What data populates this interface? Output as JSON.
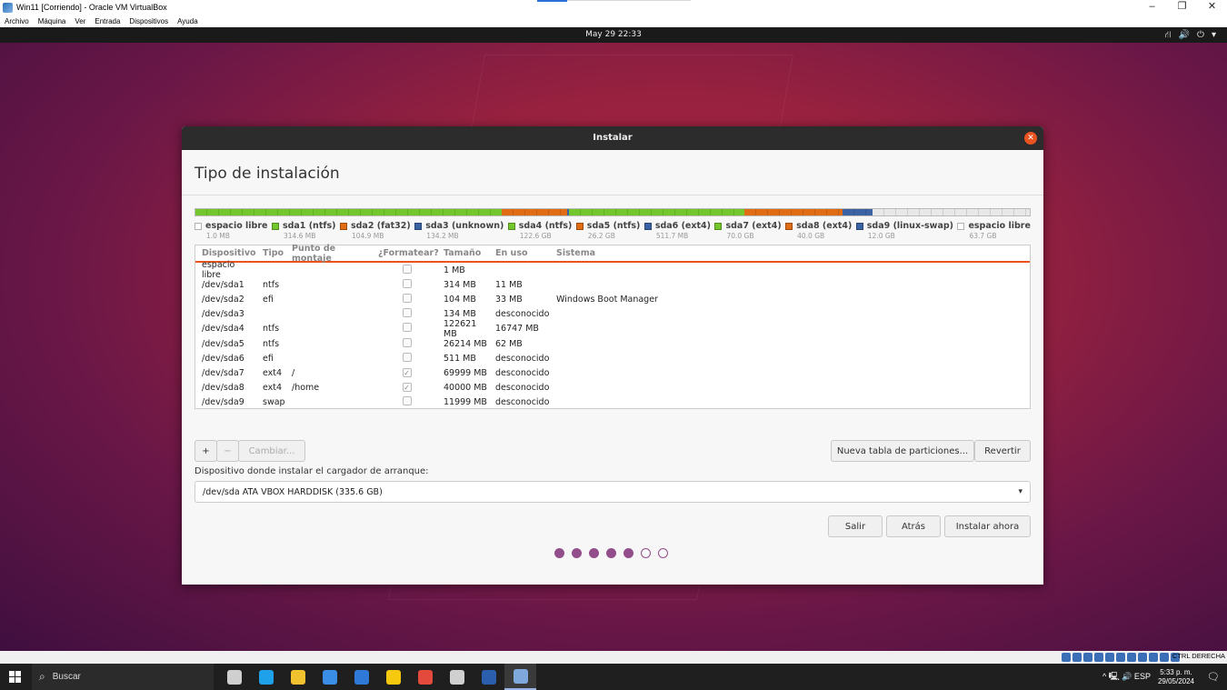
{
  "host_window": {
    "title": "Win11 [Corriendo] - Oracle VM VirtualBox",
    "menu": [
      "Archivo",
      "Máquina",
      "Ver",
      "Entrada",
      "Dispositivos",
      "Ayuda"
    ],
    "controls": {
      "minimize": "–",
      "restore": "❐",
      "close": "✕"
    }
  },
  "ubuntu_topbar": {
    "clock": "May 29  22:33",
    "tray_icons": [
      "network-icon",
      "volume-icon",
      "power-icon",
      "menu-arrow-icon"
    ],
    "tray_glyphs": [
      "⛙",
      "🔊",
      "⏻",
      "▾"
    ]
  },
  "dialog": {
    "header": "Instalar",
    "close_glyph": "✕",
    "title": "Tipo de instalación",
    "partitions_bar": [
      {
        "color": "#f0f0f0",
        "weight": 0.4
      },
      {
        "color": "#73c72c",
        "weight": 337.6
      },
      {
        "color": "#e06d14",
        "weight": 72.4
      },
      {
        "color": "#3b63a3",
        "weight": 1.2
      },
      {
        "color": "#73c72c",
        "weight": 193.8
      },
      {
        "color": "#e06d14",
        "weight": 108.6
      },
      {
        "color": "#3b63a3",
        "weight": 32.8
      },
      {
        "color": "#e8e8e8",
        "weight": 173.2
      }
    ],
    "legend": [
      {
        "name": "espacio libre",
        "size": "1.0 MB",
        "color": "#ffffff"
      },
      {
        "name": "sda1 (ntfs)",
        "size": "314.6 MB",
        "color": "#73c72c"
      },
      {
        "name": "sda2 (fat32)",
        "size": "104.9 MB",
        "color": "#e06d14"
      },
      {
        "name": "sda3 (unknown)",
        "size": "134.2 MB",
        "color": "#3b63a3"
      },
      {
        "name": "sda4 (ntfs)",
        "size": "122.6 GB",
        "color": "#73c72c"
      },
      {
        "name": "sda5 (ntfs)",
        "size": "26.2 GB",
        "color": "#e06d14"
      },
      {
        "name": "sda6 (ext4)",
        "size": "511.7 MB",
        "color": "#3b63a3"
      },
      {
        "name": "sda7 (ext4)",
        "size": "70.0 GB",
        "color": "#73c72c"
      },
      {
        "name": "sda8 (ext4)",
        "size": "40.0 GB",
        "color": "#e06d14"
      },
      {
        "name": "sda9 (linux-swap)",
        "size": "12.0 GB",
        "color": "#3b63a3"
      },
      {
        "name": "espacio libre",
        "size": "63.7 GB",
        "color": "#ffffff"
      }
    ],
    "table": {
      "headers": [
        "Dispositivo",
        "Tipo",
        "Punto de montaje",
        "¿Formatear?",
        "Tamaño",
        "En uso",
        "Sistema"
      ],
      "rows": [
        {
          "dev": "espacio libre",
          "type": "",
          "mount": "",
          "fmt": "",
          "size": "1 MB",
          "use": "",
          "sys": ""
        },
        {
          "dev": "/dev/sda1",
          "type": "ntfs",
          "mount": "",
          "fmt": "",
          "size": "314 MB",
          "use": "11 MB",
          "sys": ""
        },
        {
          "dev": "/dev/sda2",
          "type": "efi",
          "mount": "",
          "fmt": "",
          "size": "104 MB",
          "use": "33 MB",
          "sys": "Windows Boot Manager"
        },
        {
          "dev": "/dev/sda3",
          "type": "",
          "mount": "",
          "fmt": "",
          "size": "134 MB",
          "use": "desconocido",
          "sys": ""
        },
        {
          "dev": "/dev/sda4",
          "type": "ntfs",
          "mount": "",
          "fmt": "",
          "size": "122621 MB",
          "use": "16747 MB",
          "sys": ""
        },
        {
          "dev": "/dev/sda5",
          "type": "ntfs",
          "mount": "",
          "fmt": "",
          "size": "26214 MB",
          "use": "62 MB",
          "sys": ""
        },
        {
          "dev": "/dev/sda6",
          "type": "efi",
          "mount": "",
          "fmt": "",
          "size": "511 MB",
          "use": "desconocido",
          "sys": ""
        },
        {
          "dev": "/dev/sda7",
          "type": "ext4",
          "mount": "/",
          "fmt": "✓",
          "size": "69999 MB",
          "use": "desconocido",
          "sys": ""
        },
        {
          "dev": "/dev/sda8",
          "type": "ext4",
          "mount": "/home",
          "fmt": "✓",
          "size": "40000 MB",
          "use": "desconocido",
          "sys": ""
        },
        {
          "dev": "/dev/sda9",
          "type": "swap",
          "mount": "",
          "fmt": "",
          "size": "11999 MB",
          "use": "desconocido",
          "sys": ""
        }
      ]
    },
    "buttons": {
      "add": "+",
      "remove": "−",
      "change": "Cambiar...",
      "new_table": "Nueva tabla de particiones...",
      "revert": "Revertir",
      "quit": "Salir",
      "back": "Atrás",
      "install": "Instalar ahora"
    },
    "bootloader_label": "Dispositivo donde instalar el cargador de arranque:",
    "bootloader_value": "/dev/sda    ATA VBOX HARDDISK (335.6 GB)",
    "bootloader_arrow": "▾",
    "progress": {
      "total_steps": 7,
      "completed_steps": 5
    }
  },
  "vbox_status": {
    "host_key": "CTRL DERECHA"
  },
  "taskbar": {
    "search_placeholder": "Buscar",
    "search_glyph": "⌕",
    "apps": [
      {
        "name": "task-view-icon",
        "color": "#cfcfcf"
      },
      {
        "name": "edge-icon",
        "color": "#1ea1e8"
      },
      {
        "name": "file-explorer-icon",
        "color": "#f2c12e"
      },
      {
        "name": "store-icon",
        "color": "#3a8ee6"
      },
      {
        "name": "mail-icon",
        "color": "#2f7ad8"
      },
      {
        "name": "sticky-notes-icon",
        "color": "#f6c90e"
      },
      {
        "name": "chrome-icon",
        "color": "#e34a3b"
      },
      {
        "name": "3d-box-icon",
        "color": "#d0d0d0"
      },
      {
        "name": "word-icon",
        "color": "#2b5fad"
      },
      {
        "name": "virtualbox-icon",
        "color": "#7fa9dc"
      }
    ],
    "tray_text": "^  🖳  🔊  ESP",
    "time": "5:33 p. m.",
    "date": "29/05/2024",
    "notification_glyph": "🗨"
  }
}
